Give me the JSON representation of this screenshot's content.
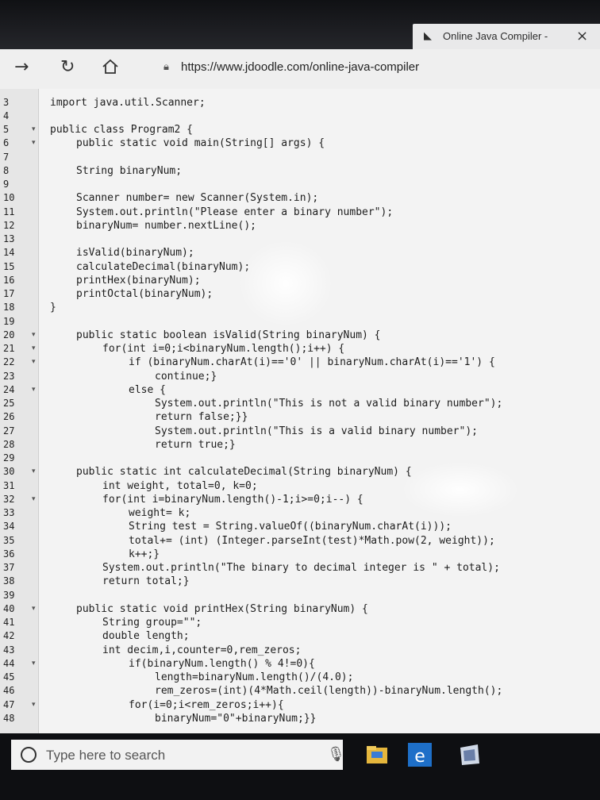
{
  "browser": {
    "tab_title": "Online Java Compiler -",
    "tab_close": "×",
    "url": "https://www.jdoodle.com/online-java-compiler",
    "icons": [
      "back-icon",
      "refresh-icon",
      "home-icon",
      "lock-icon",
      "close-icon"
    ]
  },
  "editor": {
    "lines": [
      {
        "n": "3",
        "fold": "",
        "indent": 0,
        "text": "import java.util.Scanner;"
      },
      {
        "n": "4",
        "fold": "",
        "indent": 0,
        "text": ""
      },
      {
        "n": "5",
        "fold": "▾",
        "indent": 0,
        "text": "public class Program2 {"
      },
      {
        "n": "6",
        "fold": "▾",
        "indent": 1,
        "text": "public static void main(String[] args) {"
      },
      {
        "n": "7",
        "fold": "",
        "indent": 0,
        "text": ""
      },
      {
        "n": "8",
        "fold": "",
        "indent": 1,
        "text": "String binaryNum;"
      },
      {
        "n": "9",
        "fold": "",
        "indent": 0,
        "text": ""
      },
      {
        "n": "10",
        "fold": "",
        "indent": 1,
        "text": "Scanner number= new Scanner(System.in);"
      },
      {
        "n": "11",
        "fold": "",
        "indent": 1,
        "text": "System.out.println(\"Please enter a binary number\");"
      },
      {
        "n": "12",
        "fold": "",
        "indent": 1,
        "text": "binaryNum= number.nextLine();"
      },
      {
        "n": "13",
        "fold": "",
        "indent": 0,
        "text": ""
      },
      {
        "n": "14",
        "fold": "",
        "indent": 1,
        "text": "isValid(binaryNum);"
      },
      {
        "n": "15",
        "fold": "",
        "indent": 1,
        "text": "calculateDecimal(binaryNum);"
      },
      {
        "n": "16",
        "fold": "",
        "indent": 1,
        "text": "printHex(binaryNum);"
      },
      {
        "n": "17",
        "fold": "",
        "indent": 1,
        "text": "printOctal(binaryNum);"
      },
      {
        "n": "18",
        "fold": "",
        "indent": 0,
        "text": "}"
      },
      {
        "n": "19",
        "fold": "",
        "indent": 0,
        "text": ""
      },
      {
        "n": "20",
        "fold": "▾",
        "indent": 1,
        "text": "public static boolean isValid(String binaryNum) {"
      },
      {
        "n": "21",
        "fold": "▾",
        "indent": 2,
        "text": "for(int i=0;i<binaryNum.length();i++) {"
      },
      {
        "n": "22",
        "fold": "▾",
        "indent": 3,
        "text": "if (binaryNum.charAt(i)=='0' || binaryNum.charAt(i)=='1') {"
      },
      {
        "n": "23",
        "fold": "",
        "indent": 4,
        "text": "continue;}"
      },
      {
        "n": "24",
        "fold": "▾",
        "indent": 3,
        "text": "else {"
      },
      {
        "n": "25",
        "fold": "",
        "indent": 4,
        "text": "System.out.println(\"This is not a valid binary number\");"
      },
      {
        "n": "26",
        "fold": "",
        "indent": 4,
        "text": "return false;}}"
      },
      {
        "n": "27",
        "fold": "",
        "indent": 4,
        "text": "System.out.println(\"This is a valid binary number\");"
      },
      {
        "n": "28",
        "fold": "",
        "indent": 4,
        "text": "return true;}"
      },
      {
        "n": "29",
        "fold": "",
        "indent": 0,
        "text": ""
      },
      {
        "n": "30",
        "fold": "▾",
        "indent": 1,
        "text": "public static int calculateDecimal(String binaryNum) {"
      },
      {
        "n": "31",
        "fold": "",
        "indent": 2,
        "text": "int weight, total=0, k=0;"
      },
      {
        "n": "32",
        "fold": "▾",
        "indent": 2,
        "text": "for(int i=binaryNum.length()-1;i>=0;i--) {"
      },
      {
        "n": "33",
        "fold": "",
        "indent": 3,
        "text": "weight= k;"
      },
      {
        "n": "34",
        "fold": "",
        "indent": 3,
        "text": "String test = String.valueOf((binaryNum.charAt(i)));"
      },
      {
        "n": "35",
        "fold": "",
        "indent": 3,
        "text": "total+= (int) (Integer.parseInt(test)*Math.pow(2, weight));"
      },
      {
        "n": "36",
        "fold": "",
        "indent": 3,
        "text": "k++;}"
      },
      {
        "n": "37",
        "fold": "",
        "indent": 2,
        "text": "System.out.println(\"The binary to decimal integer is \" + total);"
      },
      {
        "n": "38",
        "fold": "",
        "indent": 2,
        "text": "return total;}"
      },
      {
        "n": "39",
        "fold": "",
        "indent": 0,
        "text": ""
      },
      {
        "n": "40",
        "fold": "▾",
        "indent": 1,
        "text": "public static void printHex(String binaryNum) {"
      },
      {
        "n": "41",
        "fold": "",
        "indent": 2,
        "text": "String group=\"\";"
      },
      {
        "n": "42",
        "fold": "",
        "indent": 2,
        "text": "double length;"
      },
      {
        "n": "43",
        "fold": "",
        "indent": 2,
        "text": "int decim,i,counter=0,rem_zeros;"
      },
      {
        "n": "44",
        "fold": "▾",
        "indent": 3,
        "text": "if(binaryNum.length() % 4!=0){"
      },
      {
        "n": "45",
        "fold": "",
        "indent": 4,
        "text": "length=binaryNum.length()/(4.0);"
      },
      {
        "n": "46",
        "fold": "",
        "indent": 4,
        "text": "rem_zeros=(int)(4*Math.ceil(length))-binaryNum.length();"
      },
      {
        "n": "47",
        "fold": "▾",
        "indent": 3,
        "text": "for(i=0;i<rem_zeros;i++){"
      },
      {
        "n": "48",
        "fold": "",
        "indent": 4,
        "text": "binaryNum=\"0\"+binaryNum;}}"
      }
    ]
  },
  "taskbar": {
    "search_placeholder": "Type here to search",
    "icons": [
      "search-circle-icon",
      "microphone-icon",
      "file-explorer-icon",
      "edge-icon",
      "store-icon"
    ]
  }
}
